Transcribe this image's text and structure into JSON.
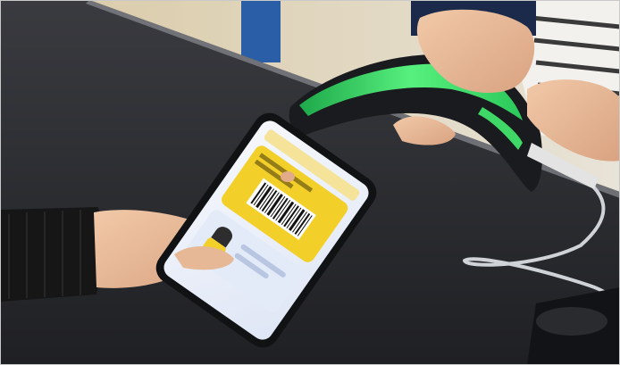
{
  "photo": {
    "scene": "",
    "phone_screen": {
      "header_text": "",
      "card_text": "",
      "barcode_present": true
    }
  },
  "colors": {
    "counter": "#2c2d31",
    "scanner_glow": "#39e06a",
    "card_yellow": "#f3cf2a",
    "screen_bg": "#eef2fb"
  }
}
